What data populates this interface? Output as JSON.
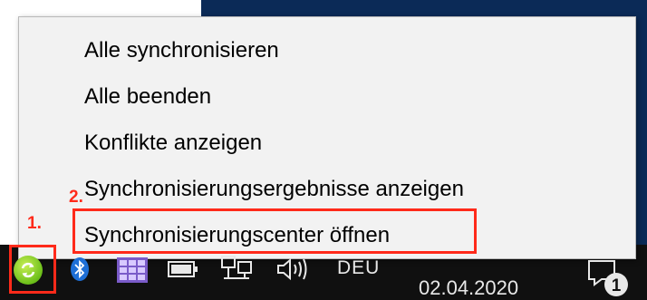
{
  "context_menu": {
    "items": [
      {
        "label": "Alle synchronisieren"
      },
      {
        "label": "Alle beenden"
      },
      {
        "label": "Konflikte anzeigen"
      },
      {
        "label": "Synchronisierungsergebnisse anzeigen"
      },
      {
        "label": "Synchronisierungscenter öffnen"
      }
    ]
  },
  "annotations": {
    "step1": "1.",
    "step2": "2.",
    "color": "#ff2a1a"
  },
  "taskbar": {
    "language": "DEU",
    "date": "02.04.2020",
    "notification_count": "1",
    "tray_icons": [
      "sync-center-icon",
      "bluetooth-icon",
      "windows-grid-icon",
      "battery-icon",
      "network-icon",
      "volume-icon"
    ]
  },
  "colors": {
    "taskbar": "#101010",
    "desktop": "#0b2a57",
    "menu_bg": "#f2f2f2",
    "sync_icon": "#6cbf1a"
  }
}
